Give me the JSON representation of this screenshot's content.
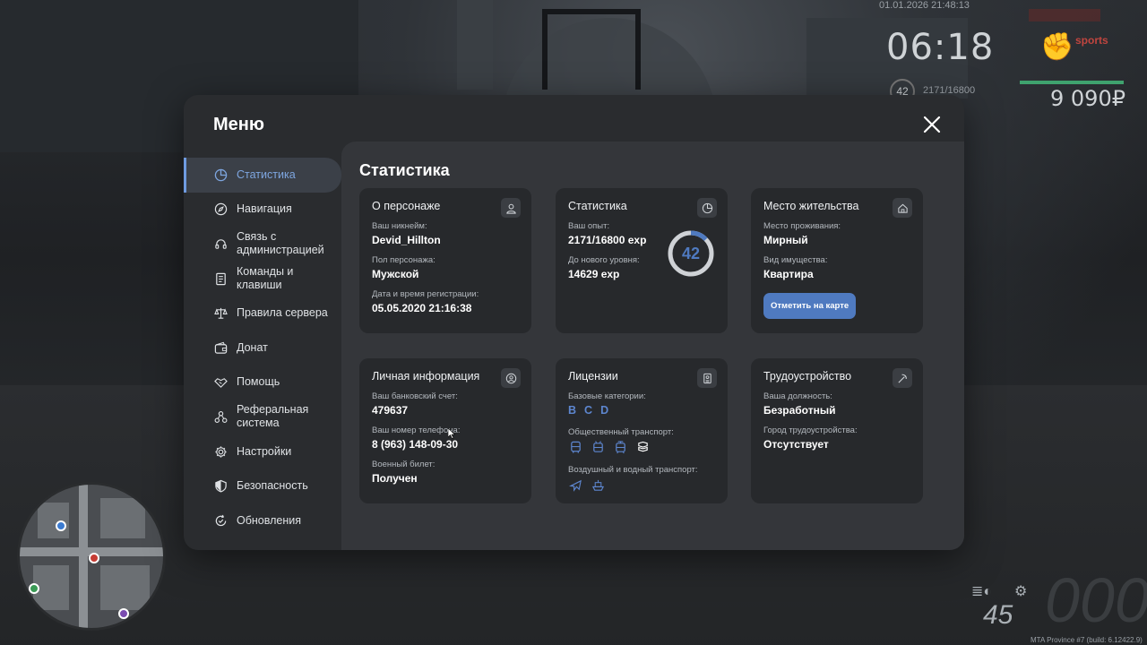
{
  "hud": {
    "datetime": "01.01.2026 21:48:13",
    "clock": "06:18",
    "sports_tag": "sports",
    "money": "9 090₽",
    "level": "42",
    "exp": "2171/16800",
    "speed": "45",
    "odometer": "000",
    "build": "MTA Province #7 (build: 6.12422.9)"
  },
  "menu": {
    "title": "Меню",
    "sidebar": [
      {
        "label": "Статистика",
        "icon": "chart-pie-icon",
        "active": true
      },
      {
        "label": "Навигация",
        "icon": "compass-icon"
      },
      {
        "label": "Связь с администрацией",
        "icon": "headset-icon"
      },
      {
        "label": "Команды и клавиши",
        "icon": "document-icon"
      },
      {
        "label": "Правила сервера",
        "icon": "scales-icon"
      },
      {
        "label": "Донат",
        "icon": "wallet-icon"
      },
      {
        "label": "Помощь",
        "icon": "handshake-icon"
      },
      {
        "label": "Реферальная система",
        "icon": "network-icon"
      },
      {
        "label": "Настройки",
        "icon": "gear-icon"
      },
      {
        "label": "Безопасность",
        "icon": "shield-icon"
      },
      {
        "label": "Обновления",
        "icon": "refresh-check-icon"
      }
    ]
  },
  "content": {
    "title": "Статистика",
    "character": {
      "title": "О персонаже",
      "nickname_label": "Ваш никнейм:",
      "nickname": "Devid_Hillton",
      "gender_label": "Пол персонажа:",
      "gender": "Мужской",
      "reg_label": "Дата и время регистрации:",
      "reg": "05.05.2020 21:16:38"
    },
    "stats": {
      "title": "Статистика",
      "exp_label": "Ваш опыт:",
      "exp": "2171/16800 exp",
      "next_label": "До нового уровня:",
      "next": "14629 exp",
      "level": "42",
      "progress": 0.129
    },
    "residence": {
      "title": "Место жительства",
      "place_label": "Место проживания:",
      "place": "Мирный",
      "property_label": "Вид имущества:",
      "property": "Квартира",
      "button": "Отметить на карте"
    },
    "personal": {
      "title": "Личная информация",
      "bank_label": "Ваш банковский счет:",
      "bank": "479637",
      "phone_label": "Ваш номер телефона:",
      "phone": "8 (963) 148-09-30",
      "military_label": "Военный билет:",
      "military": "Получен"
    },
    "licenses": {
      "title": "Лицензии",
      "base_label": "Базовые категории:",
      "categories": [
        "B",
        "C",
        "D"
      ],
      "public_label": "Общественный транспорт:",
      "air_label": "Воздушный и водный транспорт:"
    },
    "employment": {
      "title": "Трудоустройство",
      "position_label": "Ваша должность:",
      "position": "Безработный",
      "city_label": "Город трудоустройства:",
      "city": "Отсутствует"
    }
  },
  "colors": {
    "accent": "#4f7ac0",
    "active_text": "#7ea6e0",
    "card_bg": "#27292c",
    "panel_bg": "#34363a",
    "window_bg": "#2a2c2f"
  }
}
